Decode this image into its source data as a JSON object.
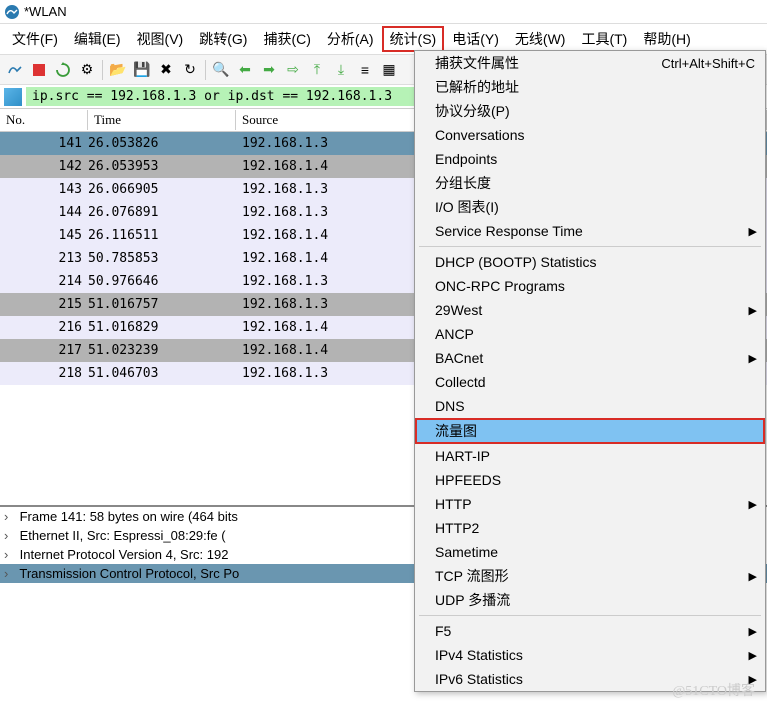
{
  "title": "*WLAN",
  "menu": [
    "文件(F)",
    "编辑(E)",
    "视图(V)",
    "跳转(G)",
    "捕获(C)",
    "分析(A)",
    "统计(S)",
    "电话(Y)",
    "无线(W)",
    "工具(T)",
    "帮助(H)"
  ],
  "menu_active_index": 6,
  "filter": "ip.src == 192.168.1.3 or ip.dst == 192.168.1.3",
  "columns": {
    "no": "No.",
    "time": "Time",
    "source": "Source"
  },
  "rows": [
    {
      "no": "141",
      "time": "26.053826",
      "src": "192.168.1.3",
      "style": "row-sel"
    },
    {
      "no": "142",
      "time": "26.053953",
      "src": "192.168.1.4",
      "style": "row-gray"
    },
    {
      "no": "143",
      "time": "26.066905",
      "src": "192.168.1.3",
      "style": "row-lav"
    },
    {
      "no": "144",
      "time": "26.076891",
      "src": "192.168.1.3",
      "style": "row-lav"
    },
    {
      "no": "145",
      "time": "26.116511",
      "src": "192.168.1.4",
      "style": "row-lav"
    },
    {
      "no": "213",
      "time": "50.785853",
      "src": "192.168.1.4",
      "style": "row-lav"
    },
    {
      "no": "214",
      "time": "50.976646",
      "src": "192.168.1.3",
      "style": "row-lav"
    },
    {
      "no": "215",
      "time": "51.016757",
      "src": "192.168.1.3",
      "style": "row-gray"
    },
    {
      "no": "216",
      "time": "51.016829",
      "src": "192.168.1.4",
      "style": "row-lav"
    },
    {
      "no": "217",
      "time": "51.023239",
      "src": "192.168.1.4",
      "style": "row-gray"
    },
    {
      "no": "218",
      "time": "51.046703",
      "src": "192.168.1.3",
      "style": "row-lav"
    }
  ],
  "details": [
    {
      "t": "Frame 141: 58 bytes on wire (464 bits",
      "sel": false
    },
    {
      "t": "Ethernet II, Src: Espressi_08:29:fe (",
      "sel": false
    },
    {
      "t": "Internet Protocol Version 4, Src: 192",
      "sel": false
    },
    {
      "t": "Transmission Control Protocol, Src Po",
      "sel": true
    }
  ],
  "dropdown": [
    {
      "t": "捕获文件属性",
      "short": "Ctrl+Alt+Shift+C"
    },
    {
      "t": "已解析的地址"
    },
    {
      "t": "协议分级(P)"
    },
    {
      "t": "Conversations"
    },
    {
      "t": "Endpoints"
    },
    {
      "t": "分组长度"
    },
    {
      "t": "I/O 图表(I)"
    },
    {
      "t": "Service Response Time",
      "sub": true
    },
    {
      "sep": true
    },
    {
      "t": "DHCP (BOOTP) Statistics"
    },
    {
      "t": "ONC-RPC Programs"
    },
    {
      "t": "29West",
      "sub": true
    },
    {
      "t": "ANCP"
    },
    {
      "t": "BACnet",
      "sub": true
    },
    {
      "t": "Collectd"
    },
    {
      "t": "DNS"
    },
    {
      "t": "流量图",
      "hl": true
    },
    {
      "t": "HART-IP"
    },
    {
      "t": "HPFEEDS"
    },
    {
      "t": "HTTP",
      "sub": true
    },
    {
      "t": "HTTP2"
    },
    {
      "t": "Sametime"
    },
    {
      "t": "TCP 流图形",
      "sub": true
    },
    {
      "t": "UDP 多播流"
    },
    {
      "sep": true
    },
    {
      "t": "F5",
      "sub": true
    },
    {
      "t": "IPv4 Statistics",
      "sub": true
    },
    {
      "t": "IPv6 Statistics",
      "sub": true
    }
  ],
  "watermark": "@51CTO博客"
}
